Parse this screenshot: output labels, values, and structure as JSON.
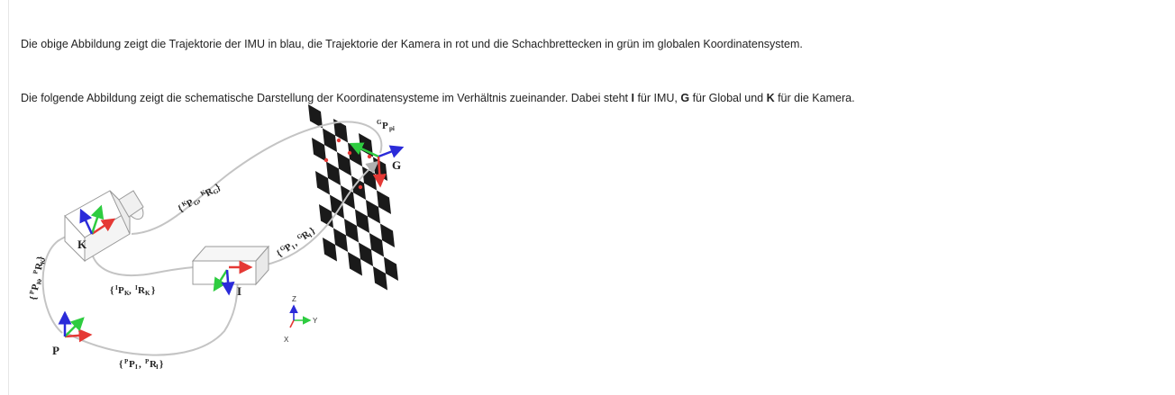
{
  "paragraphs": {
    "p1": "Die obige Abbildung zeigt die Trajektorie der IMU in blau, die Trajektorie der Kamera in rot und die Schachbrettecken in grün im globalen Koordinatensystem.",
    "p2_pre": "Die folgende Abbildung zeigt die schematische Darstellung der Koordinatensysteme im Verhältnis zueinander. Dabei steht ",
    "p2_b1": "I",
    "p2_m1": " für IMU, ",
    "p2_b2": "G",
    "p2_m2": " für Global und ",
    "p2_b3": "K",
    "p2_post": " für die Kamera."
  },
  "figure": {
    "frame_labels": {
      "K": "K",
      "I": "I",
      "G": "G",
      "P": "P"
    },
    "transform_labels": {
      "kg_main": "{",
      "kg_sup1": "K",
      "kg_p": "P",
      "kg_sub1": "G",
      "kg_comma": ", ",
      "kg_sup2": "K",
      "kg_r": "R",
      "kg_sub2": "G",
      "kg_close": "}",
      "gi_open": "{",
      "gi_sup1": "G",
      "gi_p": "P",
      "gi_sub1": "I",
      "gi_comma": ", ",
      "gi_sup2": "G",
      "gi_r": "R",
      "gi_sub2": "I",
      "gi_close": "}",
      "ik_open": "{",
      "ik_sup1": "I",
      "ik_p": "P",
      "ik_sub1": "K",
      "ik_comma": ", ",
      "ik_sup2": "I",
      "ik_r": "R",
      "ik_sub2": "K",
      "ik_close": "}",
      "pi_open": "{",
      "pi_sup1": "P",
      "pi_p": "P",
      "pi_sub1": "I",
      "pi_comma": ", ",
      "pi_sup2": "P",
      "pi_r": "R",
      "pi_sub2": "I",
      "pi_close": "}",
      "pk_open": "{",
      "pk_sup1": "P",
      "pk_p": "P",
      "pk_sub1": "K",
      "pk_comma": ", ",
      "pk_sup2": "P",
      "pk_r": "R",
      "pk_sub2": "K",
      "pk_close": "}",
      "gppi_sup": "G",
      "gppi_p": "P",
      "gppi_sub": "pi"
    },
    "axis_legend": {
      "z": "Z",
      "y": "Y",
      "x": "X"
    },
    "colors": {
      "x_axis": "#e53935",
      "y_axis": "#2ecc40",
      "z_axis": "#2b2bd9",
      "board_dark": "#1a1a1a",
      "curve": "#c8c8c8"
    }
  }
}
